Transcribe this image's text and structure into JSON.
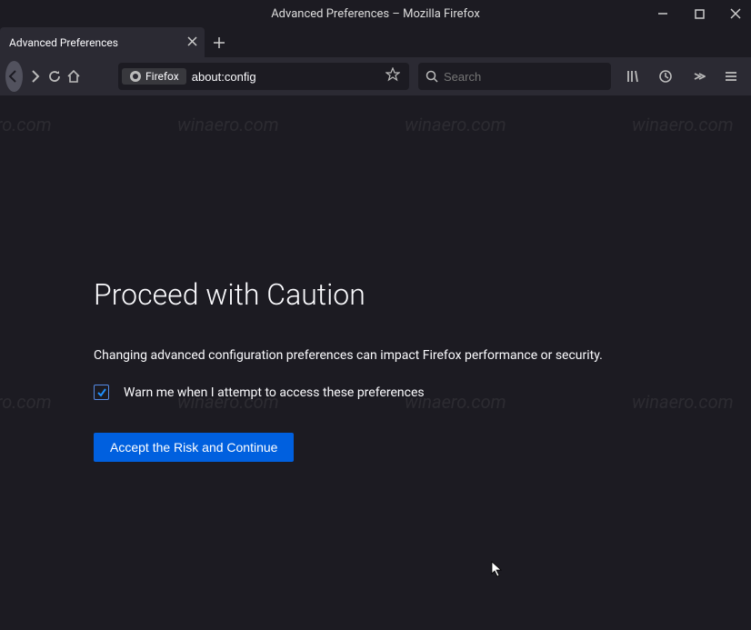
{
  "window": {
    "title": "Advanced Preferences – Mozilla Firefox"
  },
  "tab": {
    "label": "Advanced Preferences"
  },
  "urlbar": {
    "identity": "Firefox",
    "url": "about:config"
  },
  "searchbar": {
    "placeholder": "Search"
  },
  "page": {
    "heading": "Proceed with Caution",
    "description": "Changing advanced configuration preferences can impact Firefox performance or security.",
    "checkbox_label": "Warn me when I attempt to access these preferences",
    "checkbox_checked": true,
    "accept_button": "Accept the Risk and Continue"
  },
  "watermark": "winaero.com"
}
